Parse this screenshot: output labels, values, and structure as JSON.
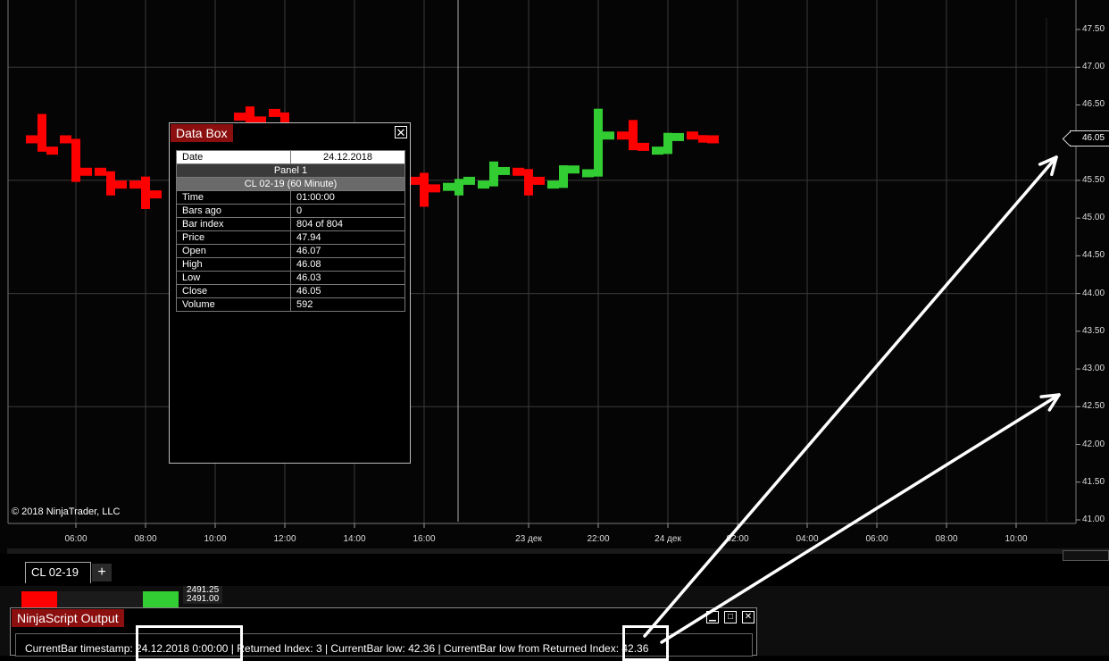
{
  "chart": {
    "copyright": "© 2018 NinjaTrader, LLC",
    "y_axis": [
      "47.50",
      "47.00",
      "46.50",
      "46.05",
      "45.50",
      "45.00",
      "44.50",
      "44.00",
      "43.50",
      "43.00",
      "42.50",
      "42.00",
      "41.50",
      "41.00"
    ],
    "y_ticks": [
      "47.50",
      "47.00",
      "46.50",
      "46.00",
      "45.50",
      "45.00",
      "44.50",
      "44.00",
      "43.50",
      "43.00",
      "42.50",
      "42.00",
      "41.50",
      "41.00"
    ],
    "x_axis": [
      "06:00",
      "08:00",
      "10:00",
      "12:00",
      "14:00",
      "16:00",
      "23 дек",
      "22:00",
      "24 дек",
      "02:00",
      "04:00",
      "06:00",
      "08:00",
      "10:00"
    ],
    "last_price": "46.05",
    "colors": {
      "up": "#32cd32",
      "down": "#ff0000",
      "grid": "#3a3a3a"
    }
  },
  "chart_data": {
    "type": "bar",
    "title": "",
    "xlabel": "",
    "ylabel": "",
    "ylim": [
      41.0,
      47.5
    ],
    "series": [
      {
        "name": "",
        "open": [
          46.07,
          46.15,
          45.95,
          45.65,
          45.52,
          45.3,
          45.25,
          46.52,
          46.35,
          45.5,
          45.55,
          45.53,
          45.5,
          45.4,
          45.5,
          45.62,
          45.35,
          45.44,
          45.57,
          45.9,
          46.1,
          45.95,
          45.95,
          46.05
        ],
        "high": [
          46.4,
          46.05,
          46.05,
          45.72,
          45.55,
          45.42,
          46.6,
          46.5,
          45.67,
          45.62,
          45.6,
          45.62,
          45.85,
          45.72,
          45.75,
          45.7,
          46.3,
          46.27,
          46.1,
          46.15,
          46.08
        ],
        "low": [
          45.85,
          45.95,
          45.48,
          45.3,
          45.1,
          45.3,
          45.3,
          45.15,
          45.25,
          45.4,
          45.38,
          45.25,
          45.43,
          45.5,
          45.5,
          45.9,
          45.9,
          45.95,
          46.03
        ],
        "close": [
          46.05,
          45.9,
          45.62,
          45.45,
          45.35,
          45.35,
          46.3,
          45.45,
          45.4,
          45.45,
          45.52,
          45.55,
          45.55,
          45.68,
          45.75,
          46.1,
          45.95,
          46.1,
          46.05,
          46.05
        ]
      }
    ]
  },
  "databox": {
    "title": "Data Box",
    "date_label": "Date",
    "date_value": "24.12.2018",
    "panel": "Panel 1",
    "instrument": "CL 02-19 (60 Minute)",
    "rows": [
      {
        "label": "Time",
        "value": "01:00:00"
      },
      {
        "label": "Bars ago",
        "value": "0"
      },
      {
        "label": "Bar index",
        "value": "804 of 804"
      },
      {
        "label": "Price",
        "value": "47.94"
      },
      {
        "label": "Open",
        "value": "46.07"
      },
      {
        "label": "High",
        "value": "46.08"
      },
      {
        "label": "Low",
        "value": "46.03"
      },
      {
        "label": "Close",
        "value": "46.05"
      },
      {
        "label": "Volume",
        "value": "592"
      }
    ]
  },
  "tabs": {
    "active": "CL 02-19",
    "add": "+"
  },
  "lower": {
    "price_tag_1": "2491.25",
    "price_tag_2": "2491.00"
  },
  "output": {
    "title": "NinjaScript Output",
    "line": "CurrentBar timestamp: 24.12.2018 0:00:00 | Returned Index: 3 | CurrentBar low: 42.36 | CurrentBar low from Returned Index: 42.36"
  }
}
